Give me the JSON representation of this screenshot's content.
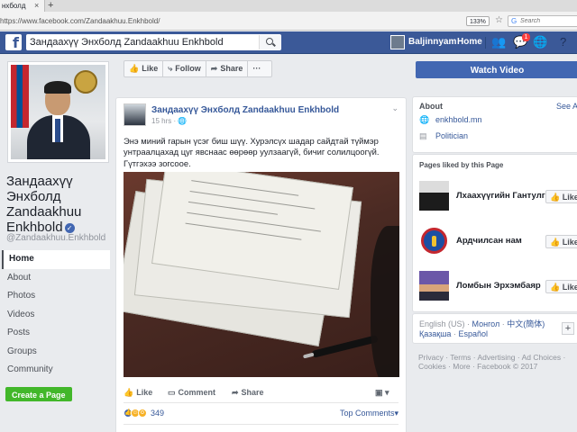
{
  "browser": {
    "tab_title": "нхболд",
    "url": "https://www.facebook.com/Zandaakhuu.Enkhbold/",
    "zoom": "133%",
    "search_placeholder": "Search"
  },
  "fb_header": {
    "search_value": "Зандаахүү Энхболд Zandaakhuu Enkhbold",
    "user_name": "Baljinnyam",
    "home_label": "Home",
    "notification_count": "1"
  },
  "page": {
    "name": "Зандаахүү Энхболд Zandaakhuu Enkhbold",
    "handle": "@Zandaakhuu.Enkhbold",
    "create_page_label": "Create a Page",
    "nav": [
      {
        "label": "Home"
      },
      {
        "label": "About"
      },
      {
        "label": "Photos"
      },
      {
        "label": "Videos"
      },
      {
        "label": "Posts"
      },
      {
        "label": "Groups"
      },
      {
        "label": "Community"
      }
    ]
  },
  "action_bar": {
    "like_label": "Like",
    "follow_label": "Follow",
    "share_label": "Share",
    "more_label": "···"
  },
  "post": {
    "author": "Зандаахүү Энхболд Zandaakhuu Enkhbold",
    "time": "15 hrs",
    "text": "Энэ миний гарын үсэг биш шүү. Хурэлсүх шадар сайдтай түймэр унтраалцахад цуг явснаас өөрөөр уулзаагүй, бичиг солилцоогүй. Гүтгэхээ зогсоое.",
    "like_label": "Like",
    "comment_label": "Comment",
    "share_label": "Share",
    "reaction_count": "349",
    "top_comments_label": "Top Comments"
  },
  "right": {
    "watch_video_label": "Watch Video",
    "about_title": "About",
    "see_all": "See A",
    "website": "enkhbold.mn",
    "category": "Politician",
    "liked_title": "Pages liked by this Page",
    "liked_pages": [
      {
        "name": "Лхаахүүгийн Гантулга",
        "like": "Like"
      },
      {
        "name": "Ардчилсан нам",
        "like": "Like"
      },
      {
        "name": "Ломбын Эрхэмбаяр",
        "like": "Like"
      }
    ],
    "languages": {
      "current": "English (US)",
      "sep1": " · ",
      "lang2": "Монгол",
      "sep2": " · ",
      "lang3": "中文(簡体)",
      "lang4": "Қазақша",
      "sep3": " · ",
      "lang5": "Español"
    },
    "footer": "Privacy · Terms · Advertising · Ad Choices · Cookies · More · Facebook © 2017"
  },
  "colors": {
    "fb_blue": "#3b5998",
    "link": "#365899",
    "create_green": "#42b72a"
  }
}
